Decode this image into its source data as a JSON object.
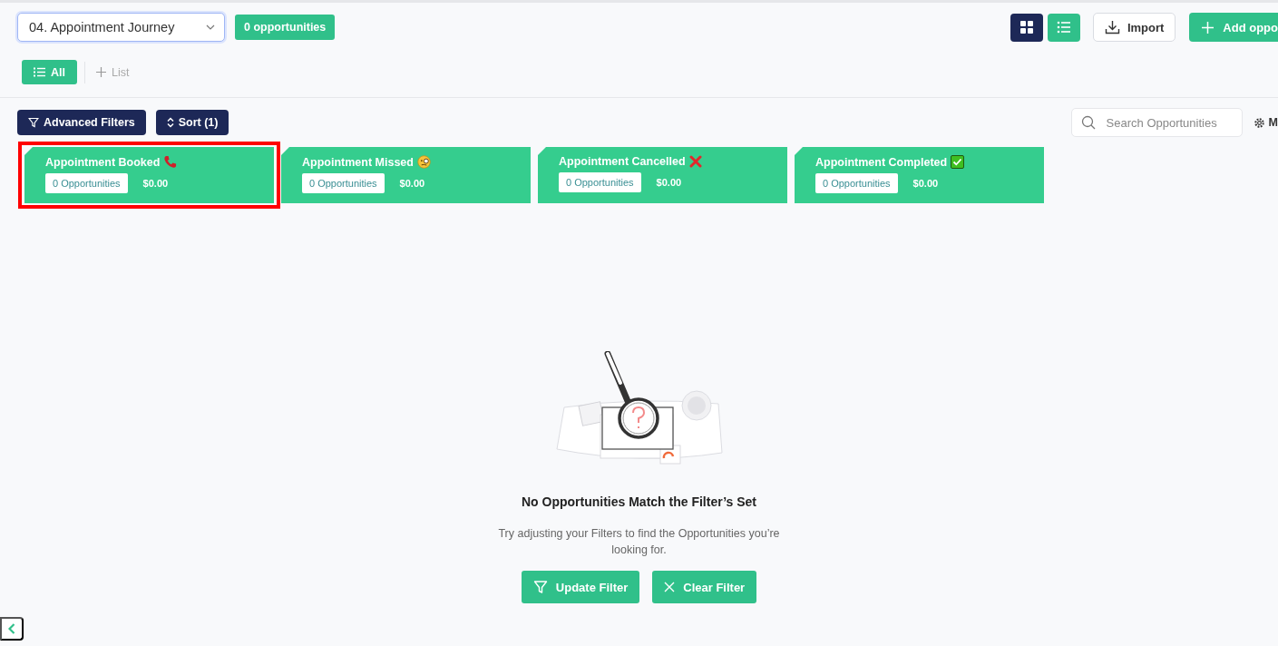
{
  "pipeline": {
    "value": "04. Appointment Journey",
    "count": "0 opportunities"
  },
  "views": [
    {
      "kind": "grid",
      "selected": true
    },
    {
      "kind": "list",
      "selected": false
    }
  ],
  "import_button": "Import",
  "add_button": "Add oppo",
  "list_tabs": [
    {
      "label": "All",
      "selected": true
    }
  ],
  "add_list": "List",
  "filters": {
    "advanced": "Advanced Filters",
    "sort": "Sort (1)"
  },
  "search": {
    "placeholder": "Search Opportunities"
  },
  "manage": "M",
  "stages": [
    {
      "name": "Appointment Booked",
      "kind": "phone",
      "highlighted": true,
      "count": "0 Opportunities",
      "amount": "$0.00"
    },
    {
      "name": "Appointment Missed",
      "kind": "face",
      "highlighted": false,
      "count": "0 Opportunities",
      "amount": "$0.00"
    },
    {
      "name": "Appointment Cancelled",
      "kind": "cross",
      "highlighted": false,
      "count": "0 Opportunities",
      "amount": "$0.00"
    },
    {
      "name": "Appointment Completed",
      "kind": "check",
      "highlighted": false,
      "count": "0 Opportunities",
      "amount": "$0.00"
    }
  ],
  "empty": {
    "title": "No Opportunities Match the Filter’s Set",
    "message": "Try adjusting your Filters to find the Opportunities you’re looking for.",
    "buttons": [
      {
        "kind": "update",
        "label": "Update Filter"
      },
      {
        "kind": "clear",
        "label": "Clear Filter"
      }
    ]
  }
}
